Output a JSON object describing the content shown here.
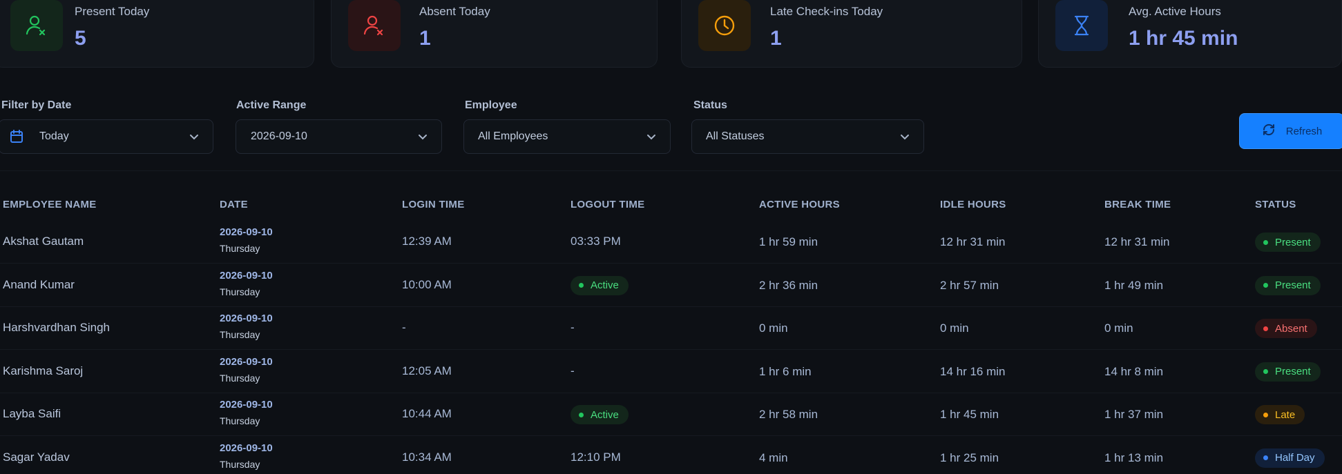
{
  "stats": [
    {
      "label": "Present Today",
      "value": "5",
      "icon": "user-check-icon",
      "color": "#22c55e"
    },
    {
      "label": "Absent Today",
      "value": "1",
      "icon": "user-x-icon",
      "color": "#ef4444"
    },
    {
      "label": "Late Check-ins Today",
      "value": "1",
      "icon": "clock-icon",
      "color": "#f59e0b"
    },
    {
      "label": "Avg. Active Hours",
      "value": "1 hr 45 min",
      "icon": "hourglass-icon",
      "color": "#3b82f6"
    }
  ],
  "filters": {
    "date": {
      "label": "Filter by Date",
      "value": "Today"
    },
    "range": {
      "label": "Active Range",
      "value": "2026-09-10"
    },
    "employee": {
      "label": "Employee",
      "value": "All Employees"
    },
    "status": {
      "label": "Status",
      "value": "All Statuses"
    },
    "refresh_label": "Refresh"
  },
  "table": {
    "headers": [
      "EMPLOYEE NAME",
      "DATE",
      "LOGIN TIME",
      "LOGOUT TIME",
      "ACTIVE HOURS",
      "IDLE HOURS",
      "BREAK TIME",
      "STATUS"
    ],
    "rows": [
      {
        "name": "Akshat Gautam",
        "date": "2026-09-10",
        "day": "Thursday",
        "login": "12:39 AM",
        "logout": "03:33 PM",
        "logout_active": false,
        "active": "1 hr 59 min",
        "idle": "12 hr 31 min",
        "break": "12 hr 31 min",
        "status": "Present"
      },
      {
        "name": "Anand Kumar",
        "date": "2026-09-10",
        "day": "Thursday",
        "login": "10:00 AM",
        "logout": "Active",
        "logout_active": true,
        "active": "2 hr 36 min",
        "idle": "2 hr 57 min",
        "break": "1 hr 49 min",
        "status": "Present"
      },
      {
        "name": "Harshvardhan Singh",
        "date": "2026-09-10",
        "day": "Thursday",
        "login": "-",
        "logout": "-",
        "logout_active": false,
        "active": "0 min",
        "idle": "0 min",
        "break": "0 min",
        "status": "Absent"
      },
      {
        "name": "Karishma Saroj",
        "date": "2026-09-10",
        "day": "Thursday",
        "login": "12:05 AM",
        "logout": "-",
        "logout_active": false,
        "active": "1 hr 6 min",
        "idle": "14 hr 16 min",
        "break": "14 hr 8 min",
        "status": "Present"
      },
      {
        "name": "Layba Saifi",
        "date": "2026-09-10",
        "day": "Thursday",
        "login": "10:44 AM",
        "logout": "Active",
        "logout_active": true,
        "active": "2 hr 58 min",
        "idle": "1 hr 45 min",
        "break": "1 hr 37 min",
        "status": "Late"
      },
      {
        "name": "Sagar Yadav",
        "date": "2026-09-10",
        "day": "Thursday",
        "login": "10:34 AM",
        "logout": "12:10 PM",
        "logout_active": false,
        "active": "4 min",
        "idle": "1 hr 25 min",
        "break": "1 hr 13 min",
        "status": "Half Day"
      }
    ]
  },
  "status_colors": {
    "Present": {
      "fg": "#4ade80",
      "bg": "#13261b",
      "dot": "#22c55e"
    },
    "Absent": {
      "fg": "#f87171",
      "bg": "#2a1416",
      "dot": "#ef4444"
    },
    "Late": {
      "fg": "#fbbf24",
      "bg": "#2a1f0d",
      "dot": "#f59e0b"
    },
    "Half Day": {
      "fg": "#93c5fd",
      "bg": "#11203a",
      "dot": "#3b82f6"
    },
    "Active": {
      "fg": "#4ade80",
      "bg": "#13261b",
      "dot": "#22c55e"
    }
  }
}
